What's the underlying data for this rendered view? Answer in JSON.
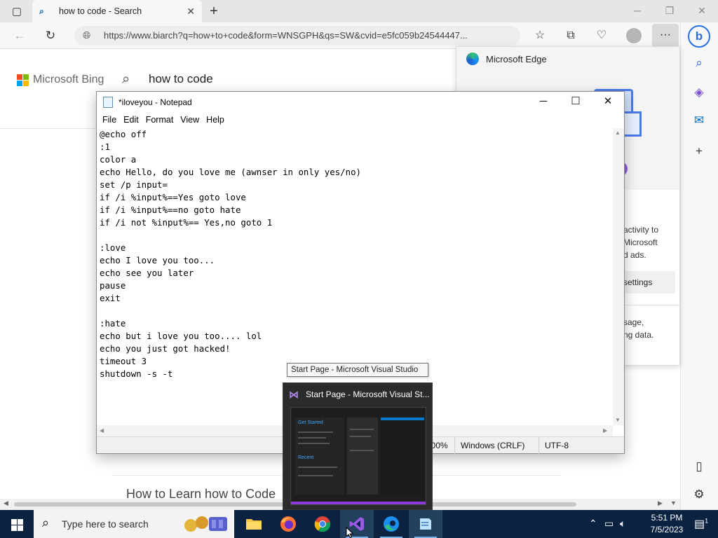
{
  "browser": {
    "tab_title": "how to code - Search",
    "new_tab_symbol": "+",
    "url": "https://www.biarch?q=how+to+code&form=WNSGPH&qs=SW&cvid=e5fc059b24544447...",
    "win_min": "─",
    "win_max": "❐",
    "win_close": "✕",
    "more_label": "···"
  },
  "bing": {
    "logo_text": "Microsoft Bing",
    "query": "how to code",
    "result_title": "How to Learn how to Code"
  },
  "edge_popup": {
    "title": "Microsoft Edge",
    "text_lines_1": [
      "activity to",
      "Microsoft",
      "d ads."
    ],
    "button_label": "settings",
    "text_lines_2": [
      "sage,",
      "ng data."
    ]
  },
  "notepad": {
    "title": "*iloveyou - Notepad",
    "menu": [
      "File",
      "Edit",
      "Format",
      "View",
      "Help"
    ],
    "content": "@echo off\n:1\ncolor a\necho Hello, do you love me (awnser in only yes/no)\nset /p input=\nif /i %input%==Yes goto love\nif /i %input%==no goto hate\nif /i not %input%== Yes,no goto 1\n\n:love\necho I love you too...\necho see you later\npause\nexit\n\n:hate\necho but i love you too.... lol\necho you just got hacked!\ntimeout 3\nshutdown -s -t",
    "status_zoom": "100%",
    "status_eol": "Windows (CRLF)",
    "status_encoding": "UTF-8"
  },
  "taskbar_preview": {
    "tooltip": "Start Page - Microsoft Visual Studio",
    "title": "Start Page - Microsoft Visual St...",
    "thumb_get_started": "Get Started",
    "thumb_recent": "Recent"
  },
  "taskbar": {
    "search_placeholder": "Type here to search",
    "time": "5:51 PM",
    "date": "7/5/2023",
    "notification_count": "1"
  },
  "colors": {
    "taskbar_bg": "#0b2340",
    "bing_accent": "#0067b8",
    "vs_purple": "#8a3ad6"
  }
}
